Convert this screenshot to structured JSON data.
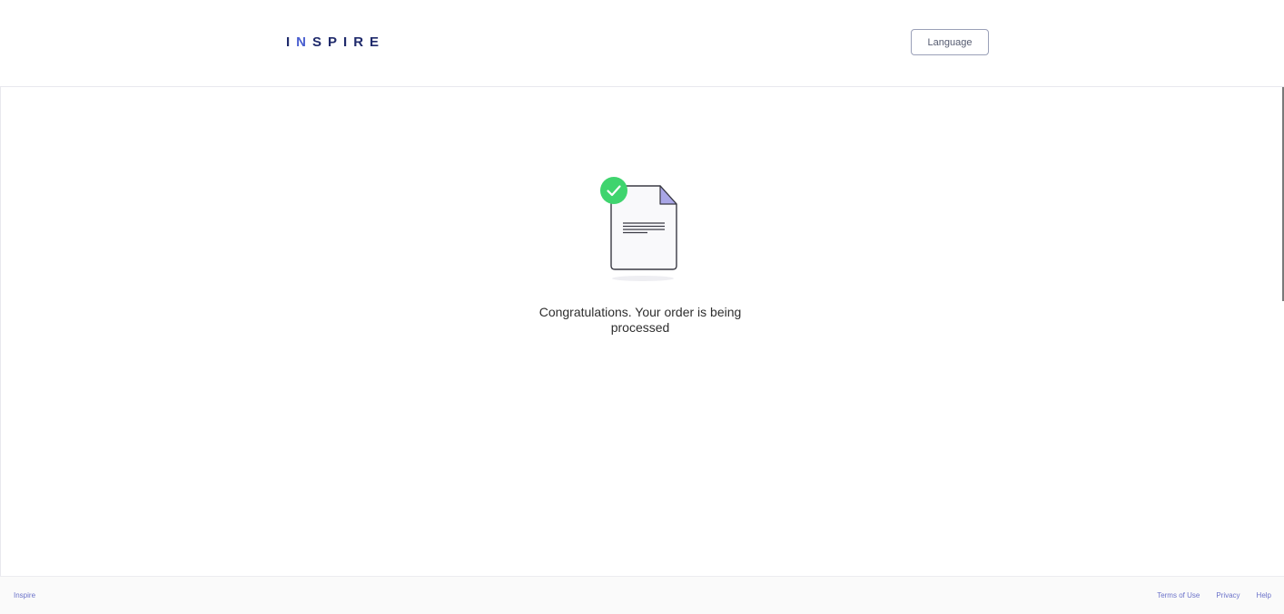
{
  "header": {
    "logo_parts": [
      "I",
      "N",
      "SPIRE"
    ],
    "language_label": "Language"
  },
  "main": {
    "message": "Congratulations. Your order is being processed",
    "icons": {
      "document": "document-icon",
      "success": "check-circle-icon"
    },
    "colors": {
      "success": "#3fd46e",
      "document_fold": "#a9a6e6"
    }
  },
  "footer": {
    "brand": "Inspire",
    "links": [
      "Terms of Use",
      "Privacy",
      "Help"
    ]
  }
}
